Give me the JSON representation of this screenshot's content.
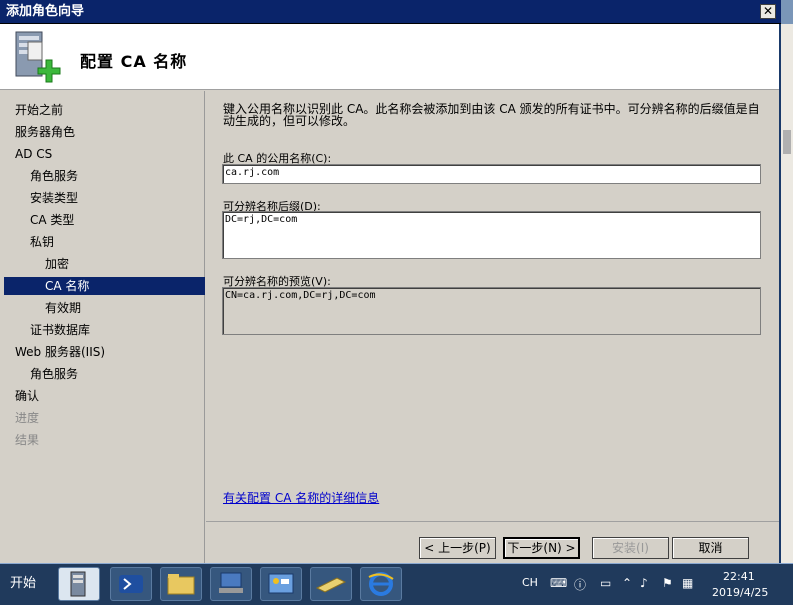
{
  "window": {
    "title": "添加角色向导",
    "close_glyph": "✕"
  },
  "header": {
    "title": "配置 CA 名称",
    "icon": "server-add-icon"
  },
  "nav": {
    "items": [
      {
        "label": "开始之前",
        "state": "normal"
      },
      {
        "label": "服务器角色",
        "state": "normal"
      },
      {
        "label": "AD CS",
        "state": "normal"
      },
      {
        "label": "角色服务",
        "state": "normal"
      },
      {
        "label": "安装类型",
        "state": "normal"
      },
      {
        "label": "CA 类型",
        "state": "normal"
      },
      {
        "label": "私钥",
        "state": "normal"
      },
      {
        "label": "加密",
        "state": "normal"
      },
      {
        "label": "CA 名称",
        "state": "selected"
      },
      {
        "label": "有效期",
        "state": "normal"
      },
      {
        "label": "证书数据库",
        "state": "normal"
      },
      {
        "label": "Web 服务器(IIS)",
        "state": "normal"
      },
      {
        "label": "角色服务",
        "state": "normal"
      },
      {
        "label": "确认",
        "state": "normal"
      },
      {
        "label": "进度",
        "state": "disabled"
      },
      {
        "label": "结果",
        "state": "disabled"
      }
    ]
  },
  "content": {
    "intro": "键入公用名称以识别此 CA。此名称会被添加到由该 CA 颁发的所有证书中。可分辨名称的后缀值是自动生成的，但可以修改。",
    "common_name_label": "此 CA 的公用名称(C):",
    "common_name_value": "ca.rj.com",
    "dn_suffix_label": "可分辨名称后缀(D):",
    "dn_suffix_value": "DC=rj,DC=com",
    "dn_preview_label": "可分辨名称的预览(V):",
    "dn_preview_value": "CN=ca.rj.com,DC=rj,DC=com",
    "details_link": "有关配置 CA 名称的详细信息"
  },
  "buttons": {
    "prev": "< 上一步(P)",
    "next": "下一步(N) >",
    "install": "安装(I)",
    "cancel": "取消"
  },
  "taskbar": {
    "start_label": "开始",
    "apps": [
      "server-manager-icon",
      "powershell-icon",
      "explorer-icon",
      "network-icon",
      "control-panel-icon",
      "notepad-icon",
      "ie-icon"
    ],
    "lang": "CH",
    "time": "22:41",
    "date": "2019/4/25"
  },
  "colors": {
    "title_bar": "#0a246a",
    "selected_nav": "#0a246a",
    "link": "#0000cc",
    "window_face": "#d4d0c8",
    "taskbar": "#203a5c"
  }
}
